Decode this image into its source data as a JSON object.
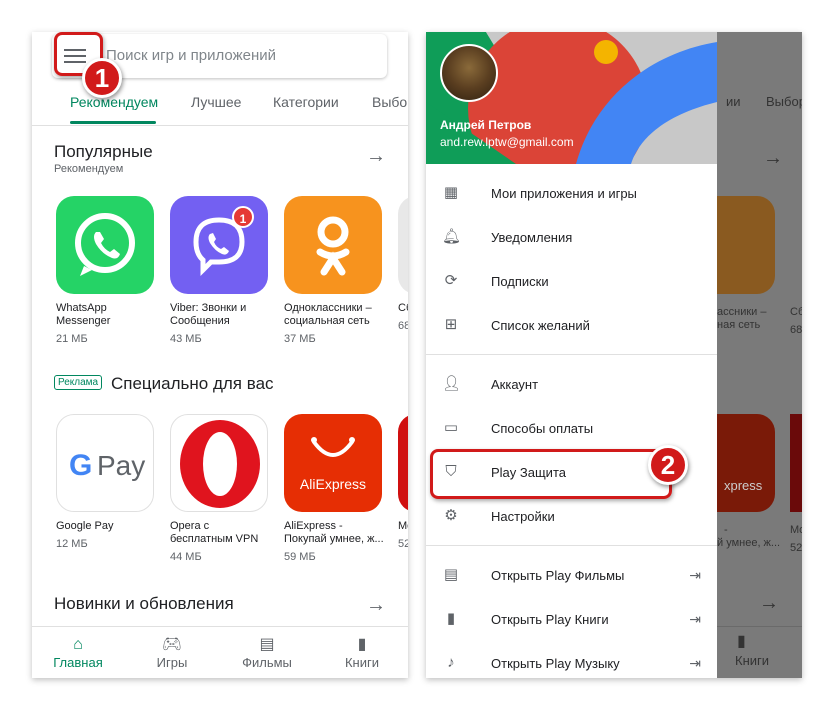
{
  "left_screen": {
    "search_placeholder": "Поиск игр и приложений",
    "tabs": [
      "Рекомендуем",
      "Лучшее",
      "Категории",
      "Выбор"
    ],
    "popular": {
      "title": "Популярные",
      "subtitle": "Рекомендуем",
      "apps": [
        {
          "name": "WhatsApp Messenger",
          "size": "21 МБ",
          "color": "#25d366"
        },
        {
          "name": "Viber: Звонки и Сообщения",
          "size": "43 МБ",
          "color": "#7360f2",
          "badge": "1"
        },
        {
          "name": "Одноклассники – социальная сеть",
          "size": "37 МБ",
          "color": "#f7931e"
        },
        {
          "name": "Сб...",
          "size": "68"
        }
      ]
    },
    "special": {
      "ad_label": "Реклама",
      "title": "Специально для вас",
      "apps": [
        {
          "name": "Google Pay",
          "size": "12 МБ"
        },
        {
          "name": "Opera с бесплатным VPN",
          "size": "44 МБ",
          "color": "#e0141e"
        },
        {
          "name": "AliExpress - Покупай умнее, ж...",
          "size": "59 МБ",
          "color": "#e62e04",
          "logo_text": "AliExpress"
        },
        {
          "name": "Mo...",
          "size": "52"
        }
      ]
    },
    "new_updates_title": "Новинки и обновления",
    "bottom_nav": [
      "Главная",
      "Игры",
      "Фильмы",
      "Книги"
    ]
  },
  "right_screen": {
    "user": {
      "name": "Андрей Петров",
      "email": "and.rew.lptw@gmail.com"
    },
    "menu_group1": [
      {
        "label": "Мои приложения и игры",
        "icon": "grid-icon"
      },
      {
        "label": "Уведомления",
        "icon": "bell-icon"
      },
      {
        "label": "Подписки",
        "icon": "refresh-icon"
      },
      {
        "label": "Список желаний",
        "icon": "bookmark-plus-icon"
      }
    ],
    "menu_group2": [
      {
        "label": "Аккаунт",
        "icon": "person-icon"
      },
      {
        "label": "Способы оплаты",
        "icon": "credit-card-icon"
      },
      {
        "label": "Play Защита",
        "icon": "shield-play-icon"
      },
      {
        "label": "Настройки",
        "icon": "gear-icon"
      }
    ],
    "menu_group3": [
      {
        "label": "Открыть Play Фильмы",
        "icon": "film-icon"
      },
      {
        "label": "Открыть Play Книги",
        "icon": "book-icon"
      },
      {
        "label": "Открыть Play Музыку",
        "icon": "music-icon"
      }
    ],
    "ghost": {
      "tabs": [
        "ии",
        "Выбор"
      ],
      "apps": [
        "ассники –",
        "ная сеть",
        "Сб",
        "68",
        "xpress",
        "- ",
        "й умнее, ж...",
        "Mo",
        "52"
      ],
      "nav": "Книги"
    }
  },
  "annotations": {
    "step1": "1",
    "step2": "2"
  }
}
